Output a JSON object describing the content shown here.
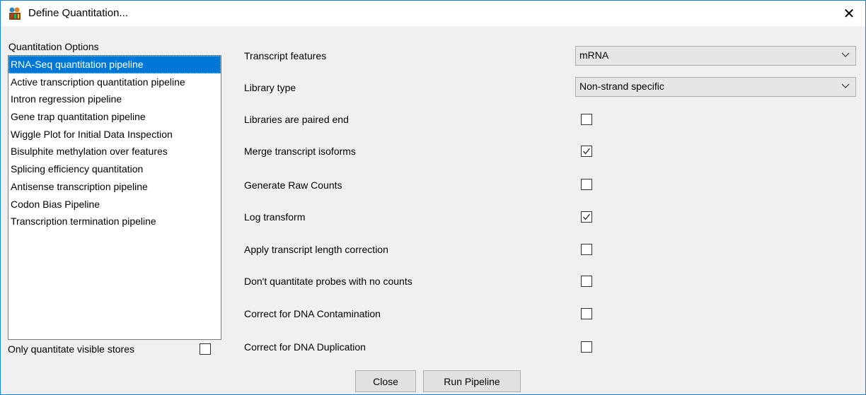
{
  "window": {
    "title": "Define Quantitation...",
    "close_glyph": "✕"
  },
  "left": {
    "options_label": "Quantitation Options",
    "items": [
      "RNA-Seq quantitation pipeline",
      "Active transcription quantitation pipeline",
      "Intron regression pipeline",
      "Gene trap quantitation pipeline",
      "Wiggle Plot for Initial Data Inspection",
      "Bisulphite methylation over features",
      "Splicing efficiency quantitation",
      "Antisense transcription pipeline",
      "Codon Bias Pipeline",
      "Transcription termination pipeline"
    ],
    "selected_index": 0,
    "visible_stores_label": "Only quantitate visible stores",
    "visible_stores_checked": false
  },
  "options": {
    "transcript_features_label": "Transcript features",
    "transcript_features_value": "mRNA",
    "library_type_label": "Library type",
    "library_type_value": "Non-strand specific",
    "paired_end_label": "Libraries are paired end",
    "paired_end_checked": false,
    "merge_isoforms_label": "Merge transcript isoforms",
    "merge_isoforms_checked": true,
    "raw_counts_label": "Generate Raw Counts",
    "raw_counts_checked": false,
    "log_transform_label": "Log transform",
    "log_transform_checked": true,
    "length_correction_label": "Apply transcript length correction",
    "length_correction_checked": false,
    "no_counts_label": "Don't quantitate probes with no counts",
    "no_counts_checked": false,
    "dna_contamination_label": "Correct for DNA Contamination",
    "dna_contamination_checked": false,
    "dna_duplication_label": "Correct for DNA Duplication",
    "dna_duplication_checked": false
  },
  "buttons": {
    "close": "Close",
    "run": "Run Pipeline"
  },
  "icons": {
    "app": "seqmonk-app-icon",
    "close": "close-icon",
    "dropdown": "chevron-down-icon",
    "check": "checkmark-icon"
  },
  "colors": {
    "selection": "#0078d7",
    "window_border": "#1883d7"
  }
}
